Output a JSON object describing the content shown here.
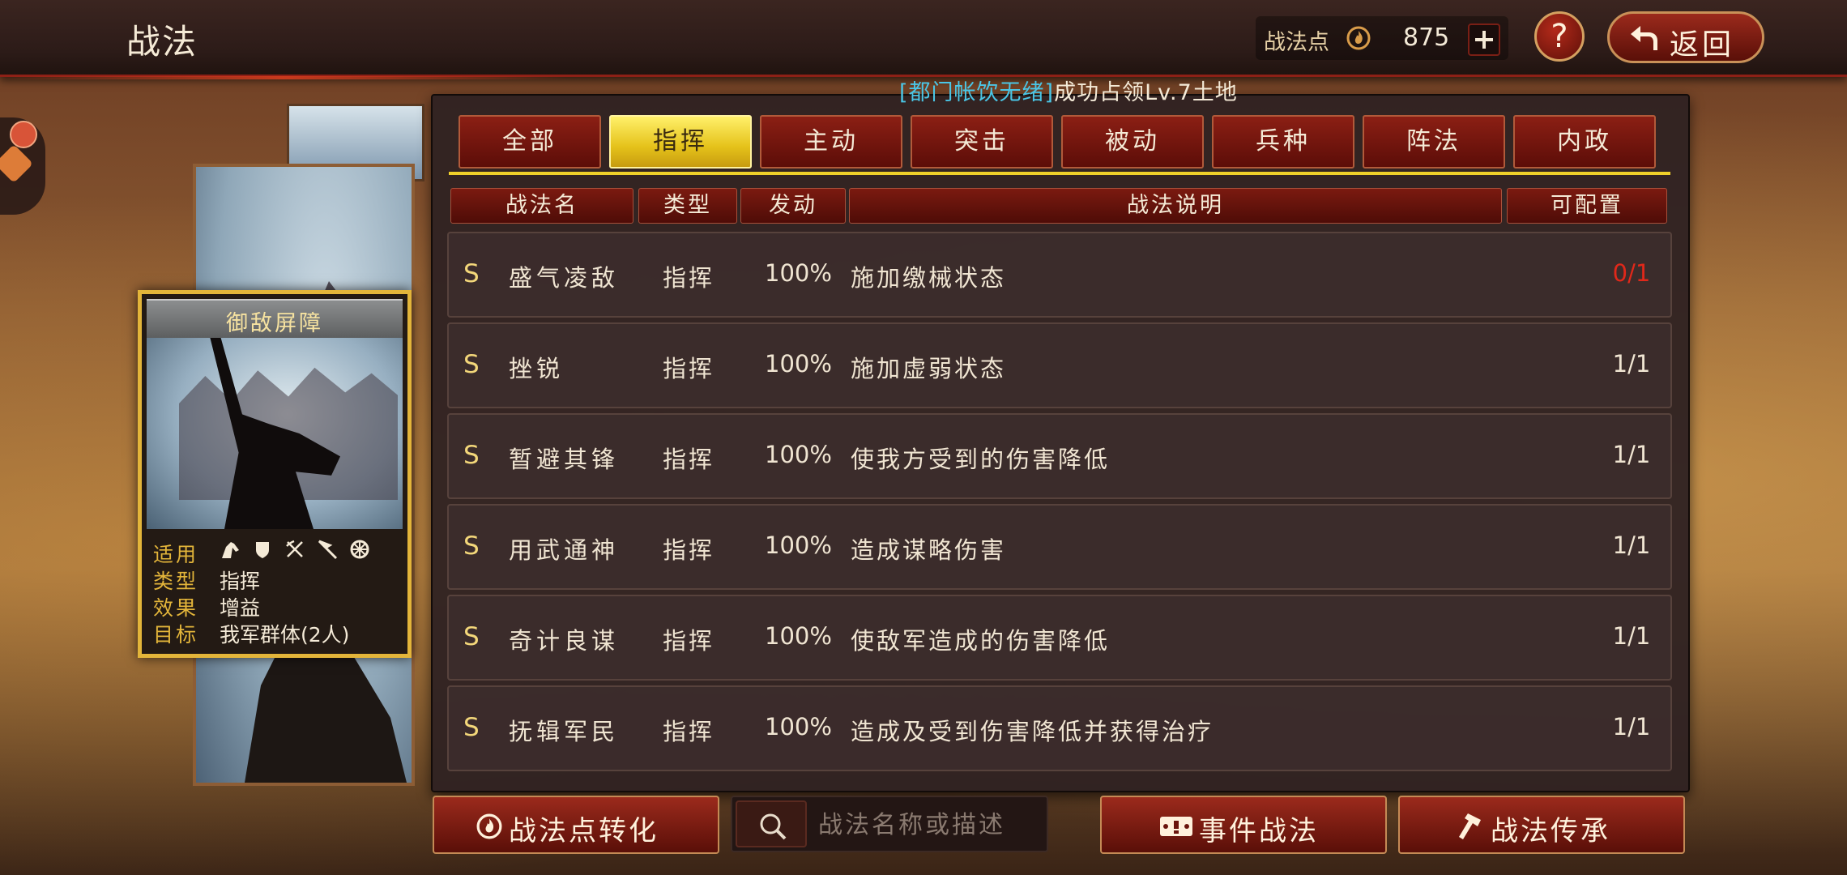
{
  "header": {
    "title": "战法",
    "points_label": "战法点",
    "points_value": "875",
    "back_label": "返回",
    "help_label": "?"
  },
  "announcement": {
    "highlight": "[都门帐饮无绪]",
    "text": "成功占领Lv.7土地"
  },
  "tactic_card": {
    "title": "御敌屏障",
    "fields": [
      {
        "key": "适用",
        "value": ""
      },
      {
        "key": "类型",
        "value": "指挥"
      },
      {
        "key": "效果",
        "value": "增益"
      },
      {
        "key": "目标",
        "value": "我军群体(2人)"
      }
    ],
    "applicable_icons": [
      "cavalry-icon",
      "shield-icon",
      "bow-icon",
      "spear-icon",
      "wheel-icon"
    ]
  },
  "tabs": [
    {
      "label": "全部",
      "active": false
    },
    {
      "label": "指挥",
      "active": true
    },
    {
      "label": "主动",
      "active": false
    },
    {
      "label": "突击",
      "active": false
    },
    {
      "label": "被动",
      "active": false
    },
    {
      "label": "兵种",
      "active": false
    },
    {
      "label": "阵法",
      "active": false
    },
    {
      "label": "内政",
      "active": false
    }
  ],
  "columns": [
    "战法名",
    "类型",
    "发动",
    "战法说明",
    "可配置"
  ],
  "rows": [
    {
      "grade": "S",
      "name": "盛气凌敌",
      "type": "指挥",
      "rate": "100%",
      "desc": "施加缴械状态",
      "slot": "0/1"
    },
    {
      "grade": "S",
      "name": "挫锐",
      "type": "指挥",
      "rate": "100%",
      "desc": "施加虚弱状态",
      "slot": "1/1"
    },
    {
      "grade": "S",
      "name": "暂避其锋",
      "type": "指挥",
      "rate": "100%",
      "desc": "使我方受到的伤害降低",
      "slot": "1/1"
    },
    {
      "grade": "S",
      "name": "用武通神",
      "type": "指挥",
      "rate": "100%",
      "desc": "造成谋略伤害",
      "slot": "1/1"
    },
    {
      "grade": "S",
      "name": "奇计良谋",
      "type": "指挥",
      "rate": "100%",
      "desc": "使敌军造成的伤害降低",
      "slot": "1/1"
    },
    {
      "grade": "S",
      "name": "抚辑军民",
      "type": "指挥",
      "rate": "100%",
      "desc": "造成及受到伤害降低并获得治疗",
      "slot": "1/1"
    }
  ],
  "bottom": {
    "convert_label": "战法点转化",
    "search_placeholder": "战法名称或描述",
    "event_label": "事件战法",
    "inherit_label": "战法传承"
  },
  "colors": {
    "tab_active": "#e5c21a",
    "button_red": "#9b2a1c",
    "slot_full_red": "#e0281a",
    "announce_highlight": "#4ac6e6"
  }
}
